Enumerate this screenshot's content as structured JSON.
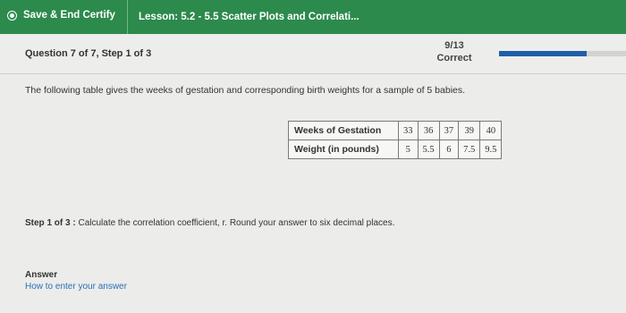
{
  "topbar": {
    "save_label": "Save & End Certify",
    "lesson_label": "Lesson: 5.2 - 5.5 Scatter Plots and Correlati..."
  },
  "question": {
    "title": "Question 7 of 7, Step 1 of 3",
    "score": "9/13",
    "status": "Correct",
    "progress_fraction": 0.69
  },
  "prompt": "The following table gives the weeks of gestation and corresponding birth weights for a sample of 5 babies.",
  "table": {
    "rows": [
      {
        "label": "Weeks of Gestation",
        "values": [
          "33",
          "36",
          "37",
          "39",
          "40"
        ]
      },
      {
        "label": "Weight (in pounds)",
        "values": [
          "5",
          "5.5",
          "6",
          "7.5",
          "9.5"
        ]
      }
    ]
  },
  "step": {
    "label": "Step 1 of 3 :",
    "text": "Calculate the correlation coefficient, r. Round your answer to six decimal places."
  },
  "answer": {
    "label": "Answer",
    "help_link": "How to enter your answer"
  },
  "colors": {
    "topbar": "#2c8a4c",
    "progress": "#1f5fa8",
    "link": "#2d6fb8"
  }
}
